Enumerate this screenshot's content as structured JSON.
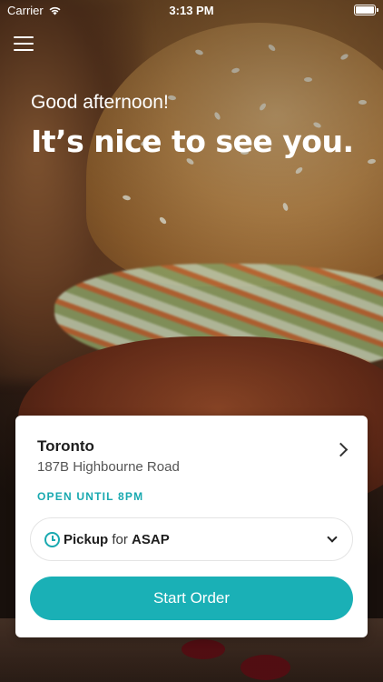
{
  "status_bar": {
    "carrier": "Carrier",
    "time": "3:13 PM"
  },
  "header": {
    "greeting": "Good afternoon!",
    "headline": "It’s nice to see you."
  },
  "location": {
    "name": "Toronto",
    "address": "187B Highbourne Road",
    "hours_status": "OPEN UNTIL 8PM"
  },
  "order_mode": {
    "mode": "Pickup",
    "connector": "for",
    "time": "ASAP"
  },
  "actions": {
    "start_order_label": "Start Order"
  },
  "colors": {
    "accent": "#1ab0b6",
    "card_background": "#ffffff"
  },
  "icons": [
    "menu-icon",
    "wifi-icon",
    "battery-icon",
    "chevron-right-icon",
    "clock-icon",
    "chevron-down-icon"
  ]
}
